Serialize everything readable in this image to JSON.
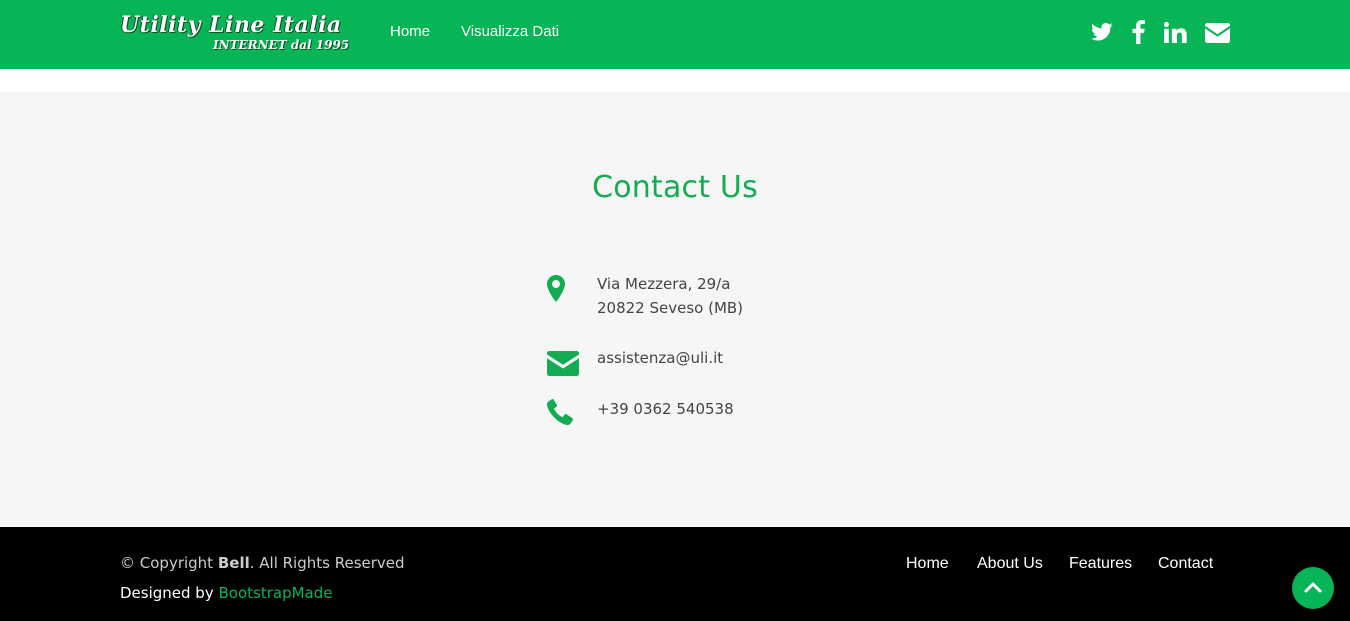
{
  "header": {
    "logo_title": "Utility Line Italia",
    "logo_subtitle": "INTERNET dal 1995",
    "nav": [
      {
        "label": "Home"
      },
      {
        "label": "Visualizza Dati"
      }
    ],
    "social_icons": [
      "twitter-icon",
      "facebook-icon",
      "linkedin-icon",
      "envelope-icon"
    ]
  },
  "contact": {
    "title": "Contact Us",
    "address_line1": "Via Mezzera, 29/a",
    "address_line2": "20822 Seveso (MB)",
    "email": "assistenza@uli.it",
    "phone": "+39 0362 540538",
    "icons": [
      "map-marker-icon",
      "envelope-icon",
      "phone-icon"
    ]
  },
  "footer": {
    "copyright_prefix": "© Copyright ",
    "copyright_brand": "Bell",
    "copyright_suffix": ". All Rights Reserved",
    "designed_prefix": "Designed by ",
    "designed_link": "BootstrapMade",
    "links": [
      {
        "label": "Home"
      },
      {
        "label": "About Us"
      },
      {
        "label": "Features"
      },
      {
        "label": "Contact"
      }
    ],
    "back_to_top_icon": "chevron-up-icon"
  },
  "colors": {
    "brand_green": "#07b456",
    "heading_green": "#14ac52",
    "section_bg": "#f6f6f6",
    "footer_bg": "#000000",
    "body_text": "#444444"
  }
}
